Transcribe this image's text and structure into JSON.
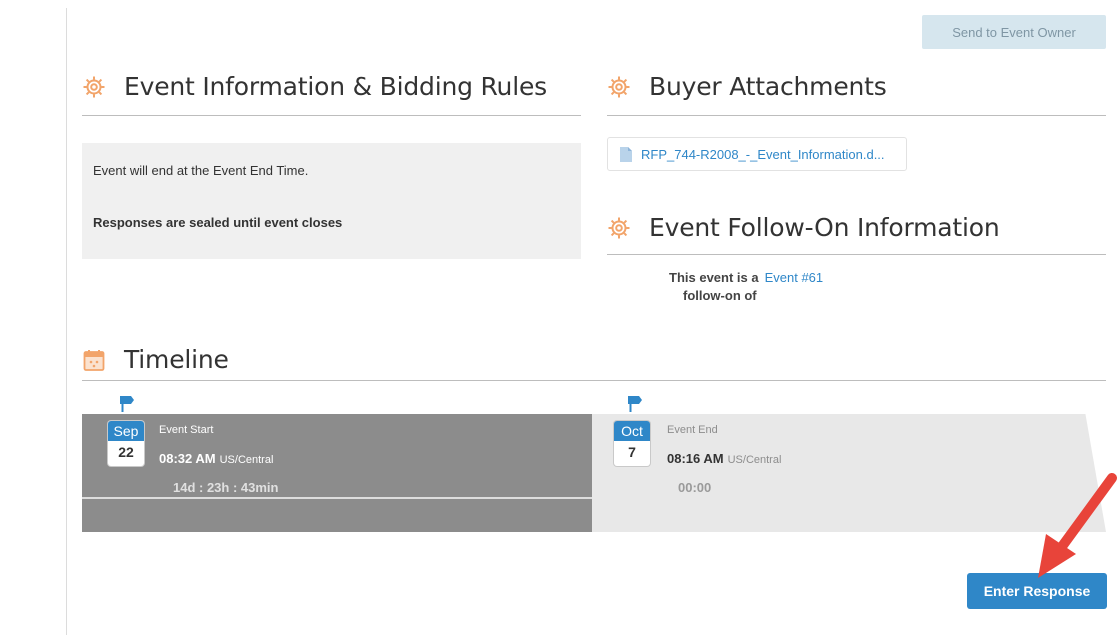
{
  "header": {
    "send_owner_label": "Send to Event Owner"
  },
  "sections": {
    "event_info": {
      "title": "Event Information & Bidding Rules",
      "line1": "Event will end at the Event End Time.",
      "line2": "Responses are sealed until event closes"
    },
    "attachments": {
      "title": "Buyer Attachments",
      "file_name": "RFP_744-R2008_-_Event_Information.d..."
    },
    "followon": {
      "title": "Event Follow-On Information",
      "line1": "This event is a",
      "line2": "follow-on of",
      "link": "Event #61"
    },
    "timeline": {
      "title": "Timeline",
      "start": {
        "month": "Sep",
        "day": "22",
        "label": "Event Start",
        "time": "08:32 AM",
        "tz": "US/Central",
        "countdown": "14d : 23h : 43min"
      },
      "end": {
        "month": "Oct",
        "day": "7",
        "label": "Event End",
        "time": "08:16 AM",
        "tz": "US/Central",
        "countdown": "00:00"
      }
    }
  },
  "footer": {
    "enter_response_label": "Enter Response"
  },
  "colors": {
    "accent": "#2f87c8",
    "section_icon": "#f2a46a",
    "annotation_arrow": "#e8443a",
    "timeline_dark": "#8c8c8c",
    "timeline_light": "#e8e8e8"
  },
  "icons": {
    "section": "gear-icon",
    "timeline": "calendar-icon",
    "attachment": "document-icon",
    "marker": "signpost-icon",
    "annotation": "red-arrow-icon"
  }
}
